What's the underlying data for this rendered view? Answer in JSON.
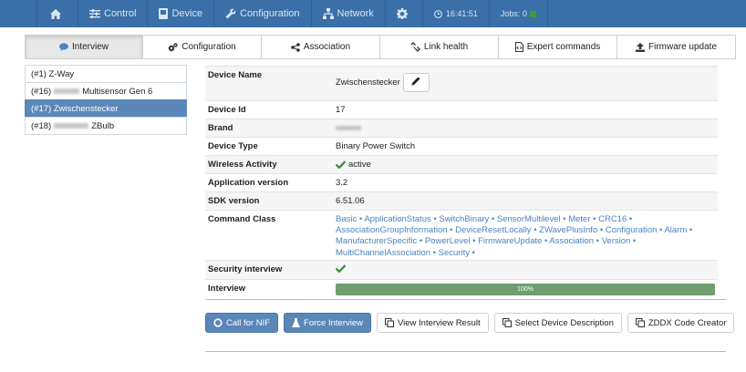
{
  "nav": {
    "control": "Control",
    "device": "Device",
    "configuration": "Configuration",
    "network": "Network",
    "time": "16:41:51",
    "jobs": "Jobs: 0"
  },
  "tabs": [
    "Interview",
    "Configuration",
    "Association",
    "Link health",
    "Expert commands",
    "Firmware update"
  ],
  "devices": [
    {
      "prefix": "(#1) Z-Way",
      "suffix": ""
    },
    {
      "prefix": "(#16)",
      "suffix": "Multisensor Gen 6"
    },
    {
      "prefix": "(#17) Zwischenstecker",
      "suffix": ""
    },
    {
      "prefix": "(#18)",
      "suffix": "ZBulb"
    }
  ],
  "details": {
    "device_name_label": "Device Name",
    "device_name": "Zwischenstecker",
    "device_id_label": "Device Id",
    "device_id": "17",
    "brand_label": "Brand",
    "device_type_label": "Device Type",
    "device_type": "Binary Power Switch",
    "wireless_label": "Wireless Activity",
    "wireless": "active",
    "app_version_label": "Application version",
    "app_version": "3.2",
    "sdk_label": "SDK version",
    "sdk": "6.51.06",
    "cc_label": "Command Class",
    "command_classes": [
      "Basic",
      "ApplicationStatus",
      "SwitchBinary",
      "SensorMultilevel",
      "Meter",
      "CRC16",
      "AssociationGroupInformation",
      "DeviceResetLocally",
      "ZWavePlusInfo",
      "Configuration",
      "Alarm",
      "ManufacturerSpecific",
      "PowerLevel",
      "FirmwareUpdate",
      "Association",
      "Version",
      "MultiChannelAssociation",
      "Security"
    ],
    "security_label": "Security interview",
    "interview_label": "Interview",
    "interview_progress": "100%"
  },
  "buttons": {
    "call_nif": "Call for NIF",
    "force_interview": "Force Interview",
    "view_result": "View Interview Result",
    "select_desc": "Select Device Description",
    "zddx": "ZDDX Code Creator"
  },
  "colors": {
    "navbar": "#3a6fa7",
    "active": "#5b87b8",
    "link": "#4a83c0",
    "progress": "#6f9e6f",
    "check": "#3c8a3c"
  }
}
